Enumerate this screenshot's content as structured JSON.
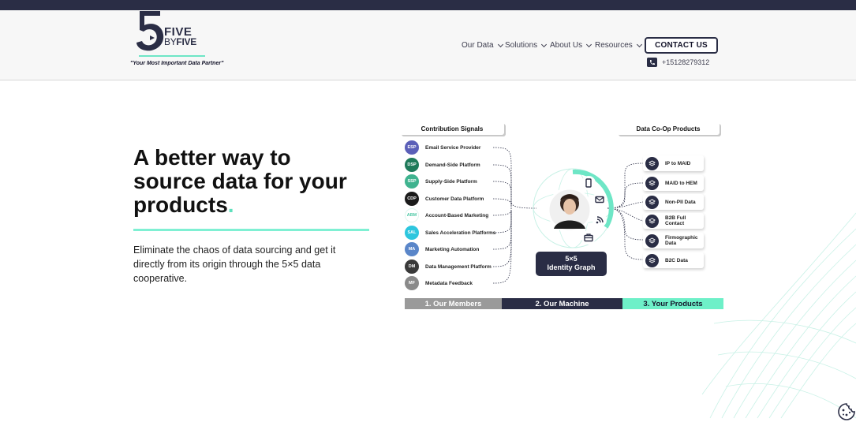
{
  "header": {
    "logo": {
      "five": "FIVE",
      "by": "BY",
      "five2": "FIVE",
      "tagline": "\"Your Most Important Data Partner\""
    },
    "nav": [
      {
        "label": "Our Data"
      },
      {
        "label": "Solutions"
      },
      {
        "label": "About Us"
      },
      {
        "label": "Resources"
      }
    ],
    "contact_label": "CONTACT US",
    "phone": "+15128279312"
  },
  "hero": {
    "title_line1": "A better way to",
    "title_line2": "source data for your",
    "title_line3": "products",
    "title_dot": ".",
    "description": "Eliminate the chaos of data sourcing and get it directly from its origin through the 5×5 data cooperative."
  },
  "diagram": {
    "left_heading": "Contribution Signals",
    "right_heading": "Data Co-Op Products",
    "members": [
      {
        "abbr": "ESP",
        "label": "Email Service Provider",
        "color": "#5b5fb8"
      },
      {
        "abbr": "DSP",
        "label": "Demand-Side Platform",
        "color": "#1f7a5a"
      },
      {
        "abbr": "SSP",
        "label": "Supply-Side Platform",
        "color": "#3fb38f"
      },
      {
        "abbr": "CDP",
        "label": "Customer Data Platform",
        "color": "#1b1b1b"
      },
      {
        "abbr": "ABM",
        "label": "Account-Based Marketing",
        "color": "#ffffff"
      },
      {
        "abbr": "SAL",
        "label": "Sales Acceleration Platforms",
        "color": "#2cc6de"
      },
      {
        "abbr": "MA",
        "label": "Marketing Automation",
        "color": "#5a86c9"
      },
      {
        "abbr": "DM",
        "label": "Data Management Platform",
        "color": "#3a3a3a"
      },
      {
        "abbr": "MF",
        "label": "Metadata Feedback",
        "color": "#8a8a8a"
      }
    ],
    "products": [
      {
        "label": "IP to MAID"
      },
      {
        "label": "MAID to HEM"
      },
      {
        "label": "Non-PII Data"
      },
      {
        "label": "B2B Full Contact"
      },
      {
        "label": "Firmographic Data"
      },
      {
        "label": "B2C Data"
      }
    ],
    "graph_line1": "5×5",
    "graph_line2": "Identity Graph",
    "stages": [
      {
        "label": "1. Our Members"
      },
      {
        "label": "2. Our Machine"
      },
      {
        "label": "3. Your Products"
      }
    ]
  },
  "colors": {
    "navy": "#2a2d45",
    "accent": "#6ee6c6"
  }
}
